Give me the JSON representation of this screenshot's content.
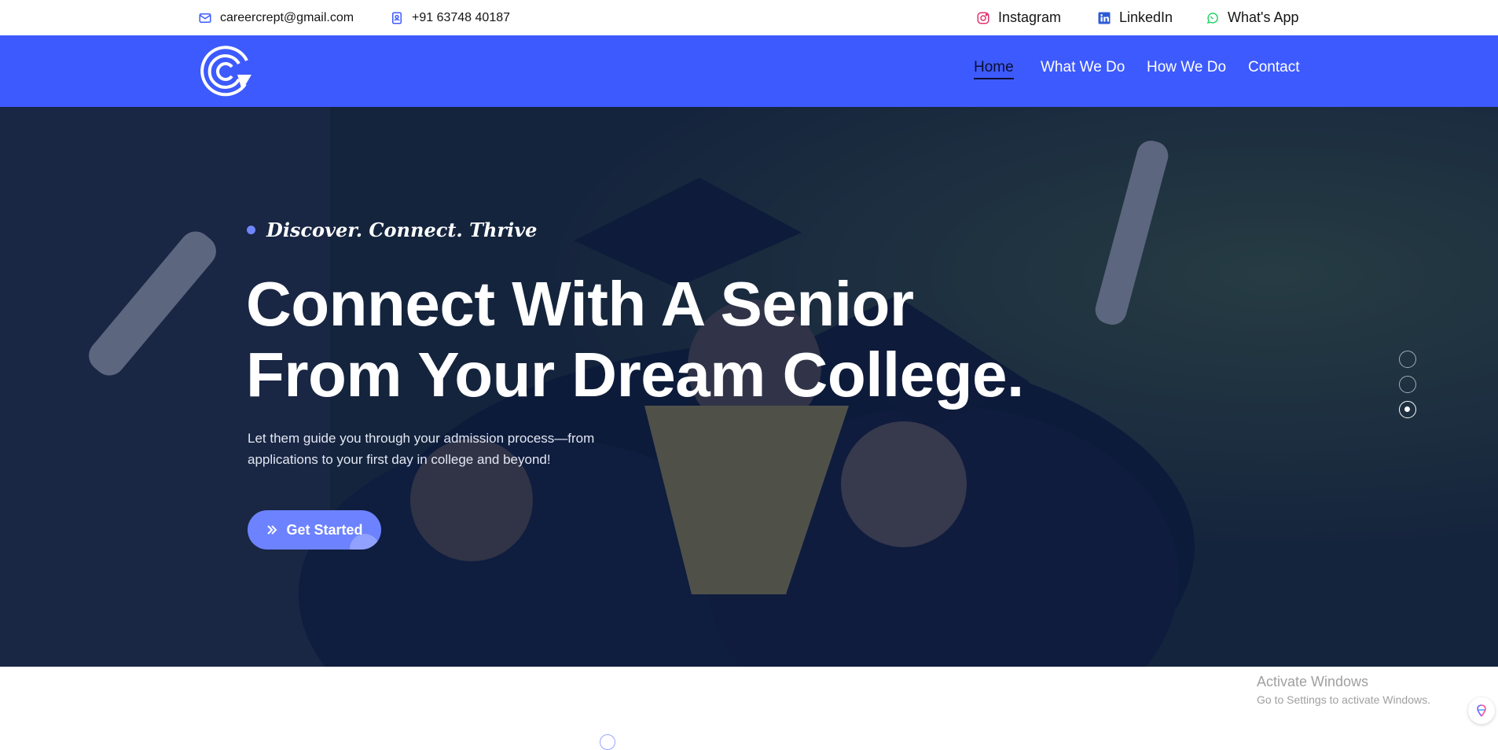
{
  "topbar": {
    "email": "careercrept@gmail.com",
    "phone": "+91 63748 40187",
    "social": {
      "instagram": "Instagram",
      "linkedin": "LinkedIn",
      "whatsapp": "What's App"
    }
  },
  "nav": {
    "items": [
      {
        "label": "Home",
        "active": true
      },
      {
        "label": "What We Do"
      },
      {
        "label": "How We Do"
      },
      {
        "label": "Contact"
      }
    ]
  },
  "hero": {
    "tagline": "Discover. Connect. Thrive",
    "headline_line1": "Connect With A Senior",
    "headline_line2": "From Your Dream College.",
    "subtext": "Let them guide you through your admission process—from applications to your first day in college and beyond!",
    "cta_label": "Get Started",
    "slides_total": 3,
    "slide_active": 3
  },
  "watermark": {
    "title": "Activate Windows",
    "subtitle": "Go to Settings to activate Windows."
  },
  "colors": {
    "brand": "#3d5afe",
    "cta": "#6c82ff",
    "instagram": "#e1306c",
    "linkedin": "#0a66c2",
    "whatsapp": "#25d366"
  },
  "icons": [
    "envelope-icon",
    "contact-card-icon",
    "instagram-icon",
    "linkedin-icon",
    "whatsapp-icon",
    "double-chevron-right-icon",
    "brain-icon"
  ]
}
